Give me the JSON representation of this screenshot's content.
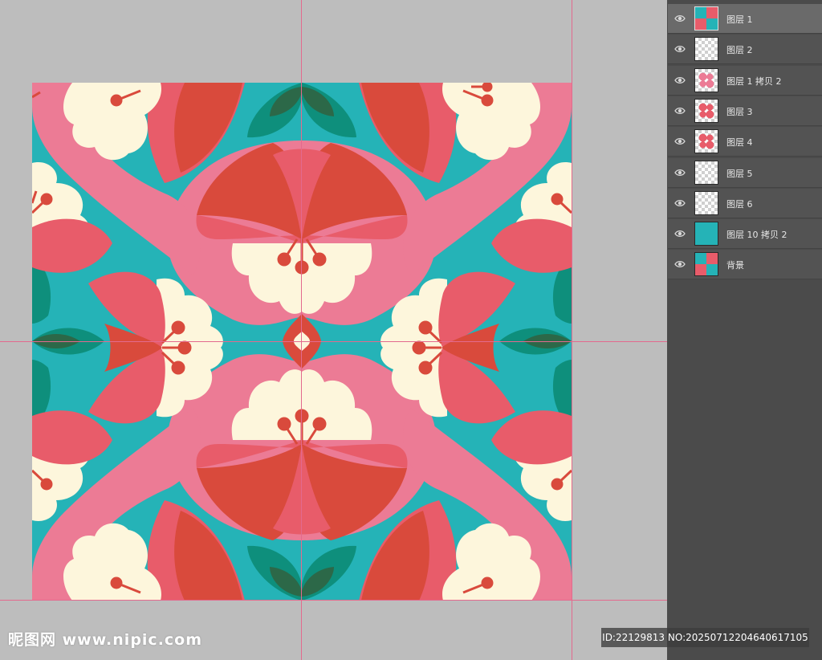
{
  "layers_panel": {
    "layers": [
      {
        "name": "图层 1",
        "selected": true,
        "thumb": "pattern-thumb"
      },
      {
        "name": "图层 2",
        "selected": false,
        "thumb": "transparent-thumb"
      },
      {
        "name": "图层 1 拷贝 2",
        "selected": false,
        "thumb": "pink-pattern-thumb"
      },
      {
        "name": "图层 3",
        "selected": false,
        "thumb": "red-pattern-thumb"
      },
      {
        "name": "图层 4",
        "selected": false,
        "thumb": "red-pattern-thumb"
      },
      {
        "name": "图层 5",
        "selected": false,
        "thumb": "transparent-thumb"
      },
      {
        "name": "图层 6",
        "selected": false,
        "thumb": "transparent-thumb"
      },
      {
        "name": "图层 10 拷贝 2",
        "selected": false,
        "thumb": "teal-fill-thumb"
      },
      {
        "name": "背景",
        "selected": false,
        "thumb": "pattern-thumb"
      }
    ]
  },
  "watermark": {
    "site_label": "昵图网 www.nipic.com",
    "id_label": "ID:22129813 NO:20250712204640617105"
  },
  "palette": {
    "teal": "#25b3b7",
    "pink": "#ec7b95",
    "coral": "#e85c6a",
    "red": "#d94a3c",
    "cream": "#fdf6dc",
    "dark_green": "#2c6848",
    "deep_teal": "#0e8f7c"
  }
}
